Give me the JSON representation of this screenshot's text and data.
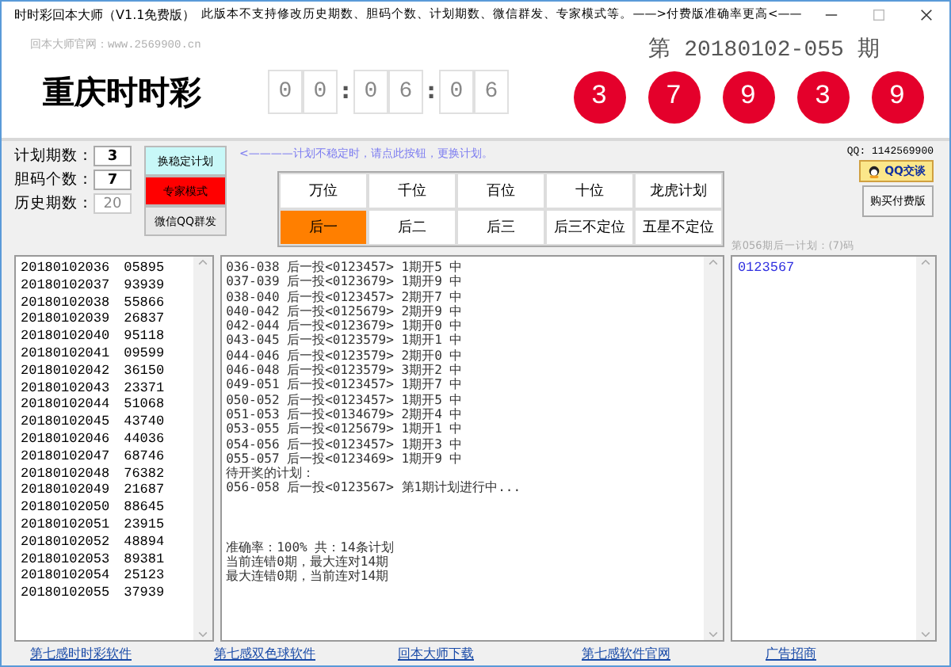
{
  "window": {
    "title": "时时彩回本大师（V1.1免费版）",
    "notice": "此版本不支持修改历史期数、胆码个数、计划期数、微信群发、专家模式等。——>付费版准确率更高<——"
  },
  "header": {
    "website": "回本大师官网：www.2569900.cn",
    "lottery_name": "重庆时时彩",
    "countdown": [
      [
        "0",
        "0"
      ],
      [
        "0",
        "6"
      ],
      [
        "0",
        "6"
      ]
    ],
    "separator": ":",
    "draw": "第 20180102-055 期",
    "balls": [
      "3",
      "7",
      "9",
      "3",
      "9"
    ]
  },
  "settings": [
    {
      "label": "计划期数：",
      "value": "3",
      "disabled": false
    },
    {
      "label": "胆码个数：",
      "value": "7",
      "disabled": false
    },
    {
      "label": "历史期数：",
      "value": "20",
      "disabled": true
    }
  ],
  "action_buttons": [
    {
      "label": "换稳定计划",
      "kind": "stable"
    },
    {
      "label": "专家模式",
      "kind": "expert"
    },
    {
      "label": "微信QQ群发",
      "kind": "share"
    }
  ],
  "hint": "<————计划不稳定时，请点此按钮，更换计划。",
  "position_tabs": [
    {
      "label": "万位",
      "selected": false
    },
    {
      "label": "千位",
      "selected": false
    },
    {
      "label": "百位",
      "selected": false
    },
    {
      "label": "十位",
      "selected": false
    },
    {
      "label": "龙虎计划",
      "selected": false
    },
    {
      "label": "后一",
      "selected": true
    },
    {
      "label": "后二",
      "selected": false
    },
    {
      "label": "后三",
      "selected": false
    },
    {
      "label": "后三不定位",
      "selected": false
    },
    {
      "label": "五星不定位",
      "selected": false
    }
  ],
  "qq": {
    "number": "QQ: 1142569900",
    "chat_button": "QQ交谈",
    "buy_button": "购买付费版"
  },
  "history": [
    {
      "issue": "20180102036",
      "numbers": "05895"
    },
    {
      "issue": "20180102037",
      "numbers": "93939"
    },
    {
      "issue": "20180102038",
      "numbers": "55866"
    },
    {
      "issue": "20180102039",
      "numbers": "26837"
    },
    {
      "issue": "20180102040",
      "numbers": "95118"
    },
    {
      "issue": "20180102041",
      "numbers": "09599"
    },
    {
      "issue": "20180102042",
      "numbers": "36150"
    },
    {
      "issue": "20180102043",
      "numbers": "23371"
    },
    {
      "issue": "20180102044",
      "numbers": "51068"
    },
    {
      "issue": "20180102045",
      "numbers": "43740"
    },
    {
      "issue": "20180102046",
      "numbers": "44036"
    },
    {
      "issue": "20180102047",
      "numbers": "68746"
    },
    {
      "issue": "20180102048",
      "numbers": "76382"
    },
    {
      "issue": "20180102049",
      "numbers": "21687"
    },
    {
      "issue": "20180102050",
      "numbers": "88645"
    },
    {
      "issue": "20180102051",
      "numbers": "23915"
    },
    {
      "issue": "20180102052",
      "numbers": "48894"
    },
    {
      "issue": "20180102053",
      "numbers": "89381"
    },
    {
      "issue": "20180102054",
      "numbers": "25123"
    },
    {
      "issue": "20180102055",
      "numbers": "37939"
    }
  ],
  "plan_log": {
    "results": [
      "036-038 后一投<0123457> 1期开5 中",
      "037-039 后一投<0123679> 1期开9 中",
      "038-040 后一投<0123457> 2期开7 中",
      "040-042 后一投<0125679> 2期开9 中",
      "042-044 后一投<0123679> 1期开0 中",
      "043-045 后一投<0123579> 1期开1 中",
      "044-046 后一投<0123579> 2期开0 中",
      "046-048 后一投<0123579> 3期开2 中",
      "049-051 后一投<0123457> 1期开7 中",
      "050-052 后一投<0123457> 1期开5 中",
      "051-053 后一投<0134679> 2期开4 中",
      "053-055 后一投<0125679> 1期开1 中",
      "054-056 后一投<0123457> 1期开3 中",
      "055-057 后一投<0123469> 1期开9 中"
    ],
    "pending_title": "待开奖的计划：",
    "pending": [
      "056-058 后一投<0123567> 第1期计划进行中..."
    ],
    "stats": [
      "准确率：100%  共：14条计划",
      "当前连错0期，最大连对14期",
      "最大连错0期，当前连对14期"
    ]
  },
  "forecast": {
    "caption": "第056期后一计划：(7)码",
    "numbers": [
      "0123567"
    ]
  },
  "footer_links": [
    "第七感时时彩软件",
    "第七感双色球软件",
    "回本大师下载",
    "第七感软件官网",
    "广告招商"
  ]
}
